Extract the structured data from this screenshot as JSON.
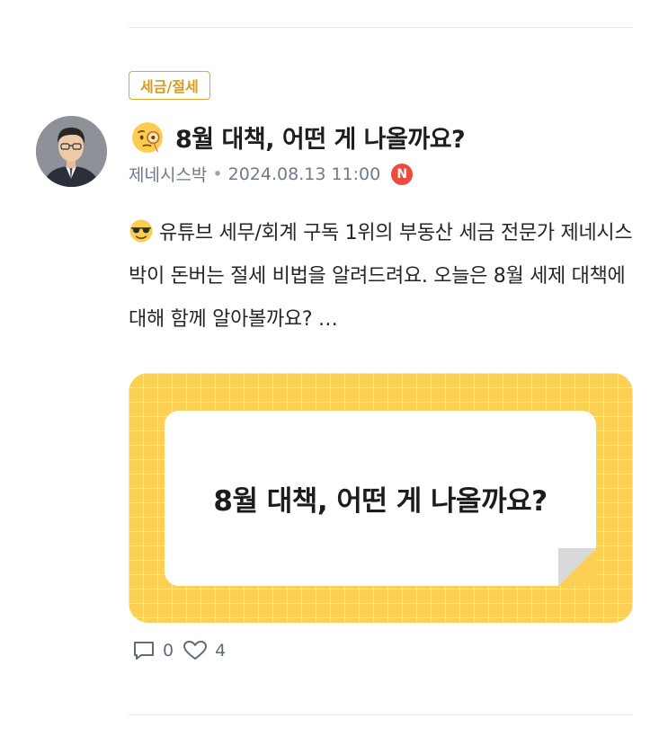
{
  "category": {
    "label": "세금/절세"
  },
  "post": {
    "title": "8월 대책, 어떤 게 나올까요?",
    "author": "제네시스박",
    "separator": "•",
    "datetime": "2024.08.13 11:00",
    "source_badge": "N",
    "body": "유튜브 세무/회계 구독 1위의 부동산 세금 전문가 제네시스박이 돈버는 절세 비법을 알려드려요. 오늘은 8월 세제 대책에 대해 함께 알아볼까요? …",
    "title_icon": "face-with-monocle-emoji",
    "body_icon": "sunglasses-emoji"
  },
  "thumbnail": {
    "text": "8월 대책, 어떤 게 나올까요?",
    "background_color": "#fccf55"
  },
  "actions": {
    "comments": "0",
    "likes": "4",
    "comment_icon": "comment-icon",
    "like_icon": "heart-icon"
  }
}
